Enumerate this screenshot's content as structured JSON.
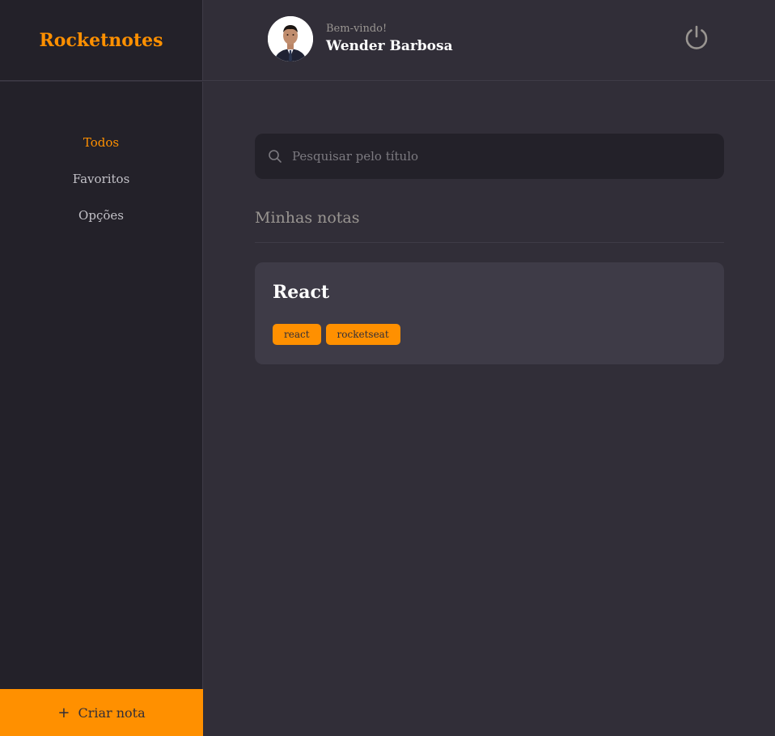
{
  "brand": {
    "name": "Rocketnotes"
  },
  "menu": {
    "items": [
      {
        "label": "Todos",
        "active": true
      },
      {
        "label": "Favoritos",
        "active": false
      },
      {
        "label": "Opções",
        "active": false
      }
    ]
  },
  "create_button": {
    "label": "Criar nota",
    "icon": "plus-icon"
  },
  "header": {
    "welcome": "Bem-vindo!",
    "username": "Wender Barbosa",
    "logout_icon": "power-icon"
  },
  "search": {
    "placeholder": "Pesquisar pelo título",
    "value": ""
  },
  "section": {
    "title": "Minhas notas"
  },
  "notes": [
    {
      "title": "React",
      "tags": [
        "react",
        "rocketseat"
      ]
    }
  ],
  "colors": {
    "accent": "#ff9000",
    "background": "#312e38",
    "sidebar": "#232129",
    "card": "#3e3b47"
  }
}
